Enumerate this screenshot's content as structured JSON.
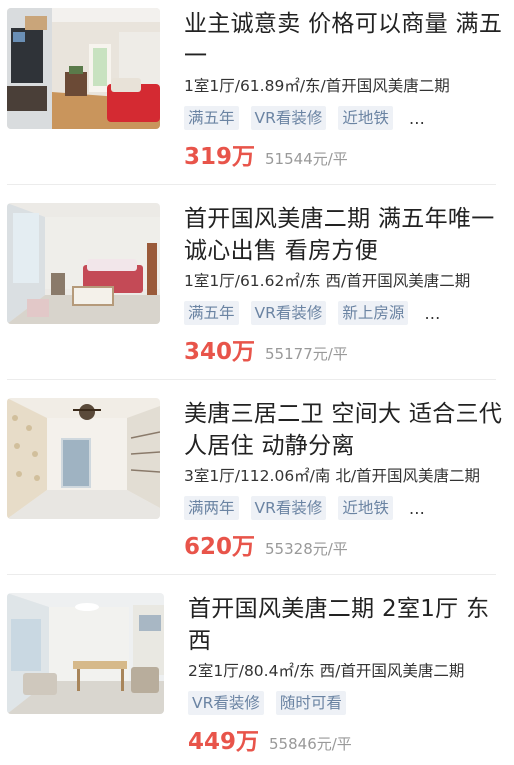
{
  "listings": [
    {
      "title": "业主诚意卖 价格可以商量 满五一",
      "meta": "1室1厅/61.89㎡/东/首开国风美唐二期",
      "tags": [
        "满五年",
        "VR看装修",
        "近地铁"
      ],
      "more": "…",
      "price": "319万",
      "unit_price": "51544元/平",
      "photo": "living-room-red-sofa"
    },
    {
      "title": "首开国风美唐二期 满五年唯一 诚心出售 看房方便",
      "meta": "1室1厅/61.62㎡/东 西/首开国风美唐二期",
      "tags": [
        "满五年",
        "VR看装修",
        "新上房源"
      ],
      "more": "…",
      "price": "340万",
      "unit_price": "55177元/平",
      "photo": "living-room-floral-sofa"
    },
    {
      "title": "美唐三居二卫 空间大 适合三代人居住 动静分离",
      "meta": "3室1厅/112.06㎡/南 北/首开国风美唐二期",
      "tags": [
        "满两年",
        "VR看装修",
        "近地铁"
      ],
      "more": "…",
      "price": "620万",
      "unit_price": "55328元/平",
      "photo": "empty-living-room-chandelier"
    },
    {
      "title": "首开国风美唐二期 2室1厅 东西",
      "meta": "2室1厅/80.4㎡/东 西/首开国风美唐二期",
      "tags": [
        "VR看装修",
        "随时可看"
      ],
      "more": "",
      "price": "449万",
      "unit_price": "55846元/平",
      "photo": "living-room-dining-table"
    }
  ],
  "colors": {
    "price": "#e8544a",
    "tag_bg": "#eef1f6",
    "tag_text": "#6b84a3",
    "unit_price": "#999999"
  }
}
